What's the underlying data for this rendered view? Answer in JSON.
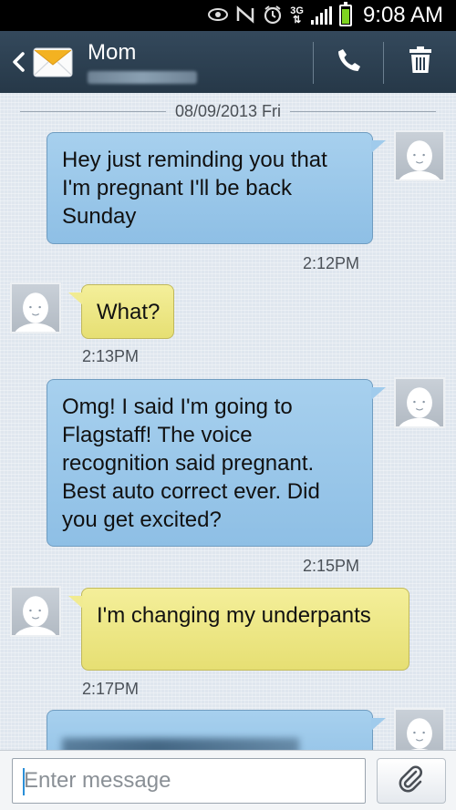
{
  "status_bar": {
    "network": "3G",
    "time": "9:08 AM",
    "icons": [
      "eye-icon",
      "nfc-icon",
      "alarm-icon",
      "network-3g-icon",
      "signal-icon",
      "battery-icon"
    ],
    "battery_level_percent": 90
  },
  "header": {
    "contact_name": "Mom",
    "icons": [
      "back-arrow-icon",
      "envelope-icon",
      "phone-icon",
      "trash-icon"
    ]
  },
  "conversation": {
    "date": "08/09/2013 Fri",
    "messages": [
      {
        "direction": "sent",
        "text": "Hey just reminding you that I'm pregnant I'll be back Sunday",
        "time": "2:12PM"
      },
      {
        "direction": "received",
        "text": "What?",
        "time": "2:13PM"
      },
      {
        "direction": "sent",
        "text": "Omg! I said I'm going to Flagstaff! The voice recognition said pregnant. Best auto correct ever. Did you get excited?",
        "time": "2:15PM"
      },
      {
        "direction": "received",
        "text": "I'm changing my underpants",
        "time": "2:17PM"
      },
      {
        "direction": "sent",
        "text": "",
        "time": ""
      }
    ]
  },
  "compose": {
    "placeholder": "Enter message",
    "value": "",
    "attach_icon": "paperclip-icon"
  },
  "colors": {
    "sent_bubble": "#9fcaeb",
    "received_bubble": "#ede784",
    "header": "#2e4254",
    "background": "#dfe6ee"
  }
}
